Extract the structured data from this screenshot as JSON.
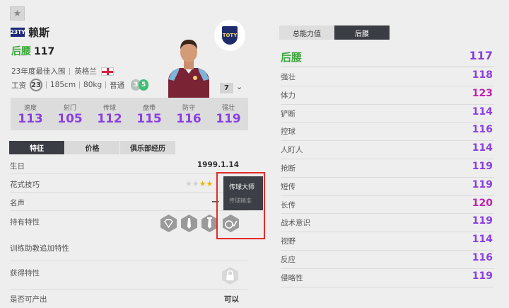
{
  "header": {
    "season_badge": "23TY",
    "player_name": "赖斯",
    "position": "后腰",
    "overall": "117",
    "award": "23年度最佳入围",
    "nation": "英格兰",
    "salary_label": "工资",
    "salary": "23",
    "height": "185cm",
    "weight": "80kg",
    "body_type": "普通",
    "foot_left": "3",
    "foot_right": "5",
    "level": "7",
    "club_badge_text": "TOTY"
  },
  "stats": [
    {
      "label": "速度",
      "value": "113"
    },
    {
      "label": "射门",
      "value": "105"
    },
    {
      "label": "传球",
      "value": "112"
    },
    {
      "label": "盘带",
      "value": "115"
    },
    {
      "label": "防守",
      "value": "116"
    },
    {
      "label": "强壮",
      "value": "119"
    }
  ],
  "left_tabs": [
    {
      "label": "特征",
      "active": true
    },
    {
      "label": "价格",
      "active": false
    },
    {
      "label": "俱乐部经历",
      "active": false
    }
  ],
  "details": {
    "birthday_label": "生日",
    "birthday": "1999.1.14",
    "skill_label": "花式技巧",
    "reputation_label": "名声",
    "reputation_value": "—",
    "traits_label": "持有特性",
    "training_label": "训练助教追加特性",
    "acquired_label": "获得特性",
    "producible_label": "是否可产出",
    "producible_value": "可以",
    "skill_stars": 2,
    "skill_stars_total": 5
  },
  "tooltip": {
    "title": "传球大师",
    "subtitle": "传球精准"
  },
  "right_tabs": [
    {
      "label": "总能力值",
      "active": false
    },
    {
      "label": "后腰",
      "active": true
    }
  ],
  "right_header": {
    "name": "后腰",
    "value": "117"
  },
  "attributes": [
    {
      "name": "强壮",
      "value": "118",
      "color": "#8a3fe0"
    },
    {
      "name": "体力",
      "value": "123",
      "color": "#c21fb0"
    },
    {
      "name": "铲断",
      "value": "114",
      "color": "#8a3fe0"
    },
    {
      "name": "控球",
      "value": "116",
      "color": "#8a3fe0"
    },
    {
      "name": "人盯人",
      "value": "114",
      "color": "#8a3fe0"
    },
    {
      "name": "抢断",
      "value": "119",
      "color": "#8a3fe0"
    },
    {
      "name": "短传",
      "value": "119",
      "color": "#8a3fe0"
    },
    {
      "name": "长传",
      "value": "120",
      "color": "#c21fb0"
    },
    {
      "name": "战术意识",
      "value": "119",
      "color": "#8a3fe0"
    },
    {
      "name": "视野",
      "value": "114",
      "color": "#8a3fe0"
    },
    {
      "name": "反应",
      "value": "116",
      "color": "#8a3fe0"
    },
    {
      "name": "侵略性",
      "value": "119",
      "color": "#8a3fe0"
    }
  ],
  "colors": {
    "accent_green": "#3ea83e",
    "stat_purple": "#8a3fe0",
    "stat_magenta": "#c21fb0",
    "tab_dark": "#3a3d44",
    "highlight_red": "#e52b2b"
  }
}
